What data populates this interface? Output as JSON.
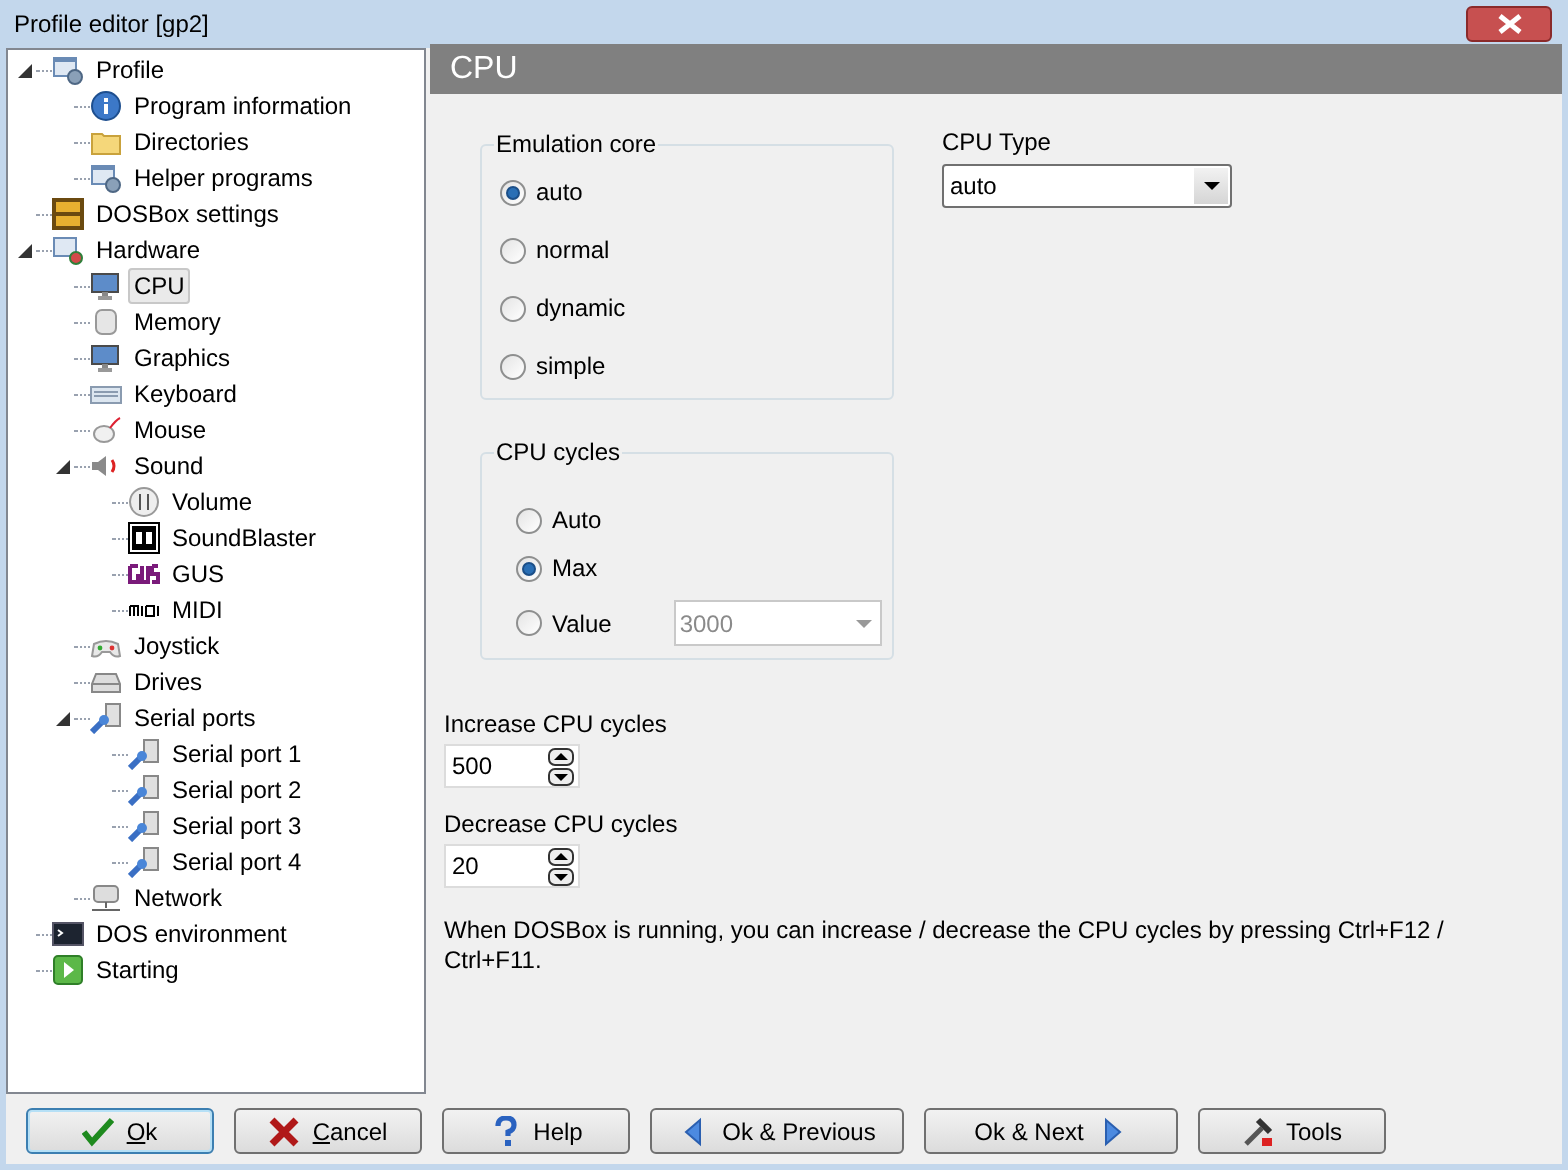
{
  "window": {
    "title": "Profile editor [gp2]"
  },
  "tree": [
    {
      "label": "Profile",
      "kind": "profile",
      "expanded": true,
      "selected": false,
      "children": [
        {
          "label": "Program information",
          "kind": "info",
          "selected": false
        },
        {
          "label": "Directories",
          "kind": "folder",
          "selected": false
        },
        {
          "label": "Helper programs",
          "kind": "profile",
          "selected": false
        }
      ]
    },
    {
      "label": "DOSBox settings",
      "kind": "dosbox",
      "selected": false
    },
    {
      "label": "Hardware",
      "kind": "hardware",
      "expanded": true,
      "selected": false,
      "children": [
        {
          "label": "CPU",
          "kind": "monitor",
          "selected": true
        },
        {
          "label": "Memory",
          "kind": "memory",
          "selected": false
        },
        {
          "label": "Graphics",
          "kind": "monitor",
          "selected": false
        },
        {
          "label": "Keyboard",
          "kind": "keyboard",
          "selected": false
        },
        {
          "label": "Mouse",
          "kind": "mouse",
          "selected": false
        },
        {
          "label": "Sound",
          "kind": "speaker",
          "expanded": true,
          "selected": false,
          "children": [
            {
              "label": "Volume",
              "kind": "volume",
              "selected": false
            },
            {
              "label": "SoundBlaster",
              "kind": "sb",
              "selected": false
            },
            {
              "label": "GUS",
              "kind": "gus",
              "selected": false
            },
            {
              "label": "MIDI",
              "kind": "midi",
              "selected": false
            }
          ]
        },
        {
          "label": "Joystick",
          "kind": "joystick",
          "selected": false
        },
        {
          "label": "Drives",
          "kind": "drive",
          "selected": false
        },
        {
          "label": "Serial ports",
          "kind": "serial",
          "expanded": true,
          "selected": false,
          "children": [
            {
              "label": "Serial port 1",
              "kind": "serial",
              "selected": false
            },
            {
              "label": "Serial port 2",
              "kind": "serial",
              "selected": false
            },
            {
              "label": "Serial port 3",
              "kind": "serial",
              "selected": false
            },
            {
              "label": "Serial port 4",
              "kind": "serial",
              "selected": false
            }
          ]
        },
        {
          "label": "Network",
          "kind": "network",
          "selected": false
        }
      ]
    },
    {
      "label": "DOS environment",
      "kind": "terminal",
      "selected": false
    },
    {
      "label": "Starting",
      "kind": "start",
      "selected": false
    }
  ],
  "page": {
    "title": "CPU",
    "emulation_core": {
      "label": "Emulation core",
      "options": [
        {
          "label": "auto",
          "selected": true
        },
        {
          "label": "normal",
          "selected": false
        },
        {
          "label": "dynamic",
          "selected": false
        },
        {
          "label": "simple",
          "selected": false
        }
      ]
    },
    "cpu_type": {
      "label": "CPU Type",
      "value": "auto"
    },
    "cpu_cycles": {
      "label": "CPU cycles",
      "options": [
        {
          "label": "Auto",
          "selected": false
        },
        {
          "label": "Max",
          "selected": true
        },
        {
          "label": "Value",
          "selected": false
        }
      ],
      "value_field": {
        "value": "3000",
        "disabled": true
      }
    },
    "increase": {
      "label": "Increase CPU cycles",
      "value": "500"
    },
    "decrease": {
      "label": "Decrease CPU cycles",
      "value": "20"
    },
    "note": "When DOSBox is running, you can increase / decrease the CPU cycles by pressing Ctrl+F12 / Ctrl+F11."
  },
  "buttons": [
    {
      "label": "Ok",
      "kind": "check",
      "underline_first": true,
      "default": true
    },
    {
      "label": "Cancel",
      "kind": "cross",
      "underline_first": true,
      "default": false
    },
    {
      "label": "Help",
      "kind": "help",
      "underline_first": false,
      "default": false
    },
    {
      "label": "Ok & Previous",
      "kind": "prev",
      "underline_first": false,
      "default": false
    },
    {
      "label": "Ok & Next",
      "kind": "next",
      "underline_first": false,
      "default": false
    },
    {
      "label": "Tools",
      "kind": "tools",
      "underline_first": false,
      "default": false
    }
  ]
}
